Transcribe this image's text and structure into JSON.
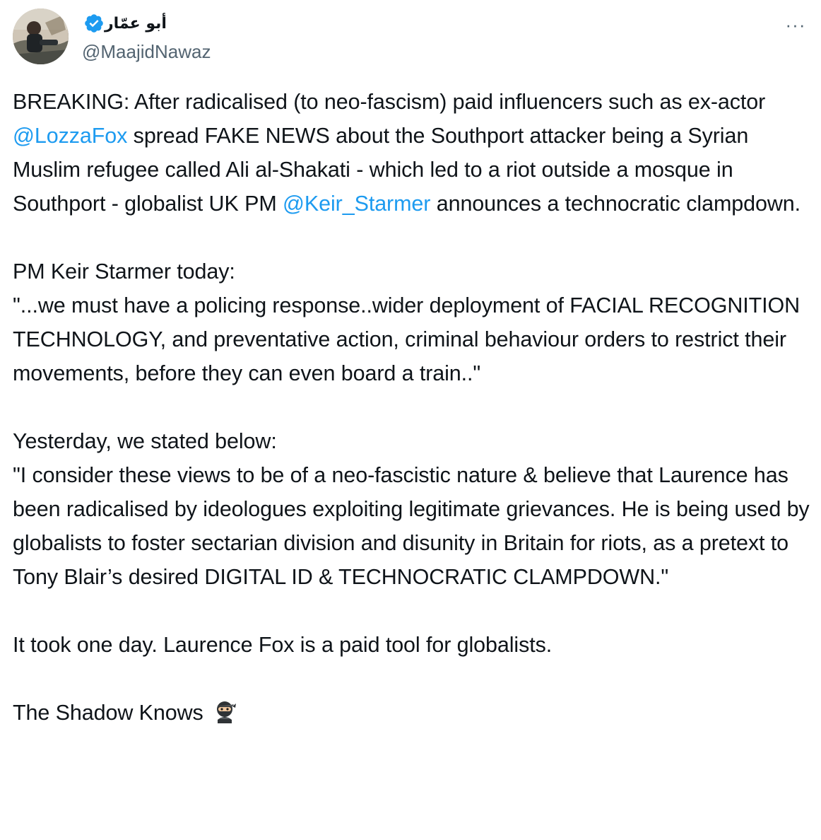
{
  "author": {
    "display_name": "أبو عمّار",
    "handle": "@MaajidNawaz",
    "verified": true
  },
  "more_menu": {
    "label": "···",
    "icon": "more-horizontal-icon"
  },
  "tweet": {
    "p1_a": "BREAKING: After radicalised (to neo-fascism) paid influencers such as ex-actor ",
    "mention1": "@LozzaFox",
    "p1_b": " spread FAKE NEWS about the Southport attacker being a Syrian Muslim refugee called Ali al-Shakati - which led to a riot outside a mosque in Southport - globalist UK PM ",
    "mention2": "@Keir_Starmer",
    "p1_c": " announces a technocratic clampdown.",
    "p2_line1": "PM Keir Starmer today:",
    "p2_line2": "\"...we must have a policing response..wider deployment of FACIAL RECOGNITION TECHNOLOGY, and preventative action, criminal behaviour orders to restrict their movements, before they can even board a train..\"",
    "p3_line1": "Yesterday, we stated below:",
    "p3_line2": "\"I consider these views to be of a neo-fascistic nature & believe that Laurence has been radicalised by ideologues exploiting legitimate grievances. He is being used by globalists to foster sectarian division and disunity in Britain for riots, as a pretext to Tony Blair’s desired DIGITAL ID & TECHNOCRATIC CLAMPDOWN.\"",
    "p4": "It took one day. Laurence Fox is a paid tool for globalists.",
    "p5": "The Shadow Knows",
    "p5_emoji": "ninja-emoji"
  },
  "colors": {
    "text": "#0f1419",
    "secondary": "#536471",
    "link": "#1d9bf0",
    "verified": "#1d9bf0"
  }
}
